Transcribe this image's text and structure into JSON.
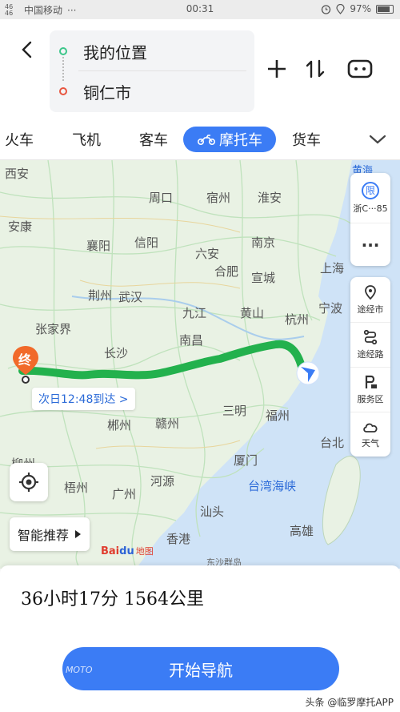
{
  "status_bar": {
    "signal_top": "46",
    "signal_bottom": "46",
    "carrier": "中国移动",
    "dots": "···",
    "time": "00:31",
    "battery": "97%"
  },
  "route": {
    "origin": "我的位置",
    "destination": "铜仁市",
    "origin_color": "#3cc68a",
    "destination_color": "#e8553f"
  },
  "tabs": [
    {
      "label": "火车",
      "active": false
    },
    {
      "label": "飞机",
      "active": false
    },
    {
      "label": "客车",
      "active": false
    },
    {
      "label": "摩托车",
      "active": true
    },
    {
      "label": "货车",
      "active": false
    }
  ],
  "map": {
    "cities": [
      {
        "name": "西安"
      },
      {
        "name": "安康"
      },
      {
        "name": "周口"
      },
      {
        "name": "宿州"
      },
      {
        "name": "淮安"
      },
      {
        "name": "襄阳"
      },
      {
        "name": "信阳"
      },
      {
        "name": "六安"
      },
      {
        "name": "南京"
      },
      {
        "name": "上海"
      },
      {
        "name": "荆州"
      },
      {
        "name": "武汉"
      },
      {
        "name": "合肥"
      },
      {
        "name": "宣城"
      },
      {
        "name": "宁波"
      },
      {
        "name": "张家界"
      },
      {
        "name": "九江"
      },
      {
        "name": "黄山"
      },
      {
        "name": "杭州"
      },
      {
        "name": "南昌"
      },
      {
        "name": "长沙"
      },
      {
        "name": "三明"
      },
      {
        "name": "福州"
      },
      {
        "name": "郴州"
      },
      {
        "name": "赣州"
      },
      {
        "name": "台北"
      },
      {
        "name": "厦门"
      },
      {
        "name": "梧州"
      },
      {
        "name": "广州"
      },
      {
        "name": "河源"
      },
      {
        "name": "汕头"
      },
      {
        "name": "高雄"
      },
      {
        "name": "香港"
      },
      {
        "name": "柳州"
      }
    ],
    "sea_labels": [
      {
        "name": "台湾海峡"
      },
      {
        "name": "黄海"
      },
      {
        "name": "东沙群岛"
      }
    ],
    "end_marker": "终",
    "arrival": "次日12:48到达 >",
    "smart_recommend": "智能推荐",
    "logo_bai": "Bai",
    "logo_du": "du",
    "logo_sub": "地图",
    "route_color": "#23b14d",
    "restriction": {
      "badge": "限",
      "plate": "浙C···85"
    },
    "more_label": "···",
    "side_tools": [
      {
        "label": "途经市",
        "icon": "pin-icon"
      },
      {
        "label": "途经路",
        "icon": "road-icon"
      },
      {
        "label": "服务区",
        "icon": "parking-icon"
      },
      {
        "label": "天气",
        "icon": "cloud-icon"
      }
    ]
  },
  "bottom": {
    "summary": "36小时17分  1564公里",
    "nav_button": "开始导航",
    "watermark_left": "LO MOTO",
    "watermark_right": "头条 @临罗摩托APP",
    "accent": "#3b7cf5"
  }
}
